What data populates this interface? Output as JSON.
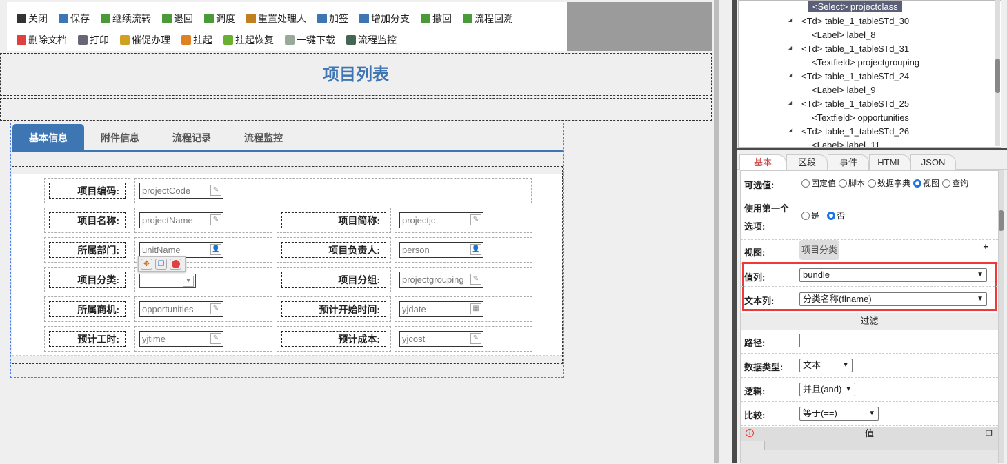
{
  "toolbar": {
    "row1": [
      {
        "label": "关闭",
        "icon": "close-icon",
        "color": "#333"
      },
      {
        "label": "保存",
        "icon": "save-icon",
        "color": "#3e76b4"
      },
      {
        "label": "继续流转",
        "icon": "forward-icon",
        "color": "#4a9a3a"
      },
      {
        "label": "退回",
        "icon": "back-arrow-icon",
        "color": "#4a9a3a"
      },
      {
        "label": "调度",
        "icon": "dispatch-icon",
        "color": "#4a9a3a"
      },
      {
        "label": "重置处理人",
        "icon": "reset-user-icon",
        "color": "#c08020"
      },
      {
        "label": "加签",
        "icon": "add-signer-icon",
        "color": "#3e76b4"
      },
      {
        "label": "增加分支",
        "icon": "branch-icon",
        "color": "#3e76b4"
      },
      {
        "label": "撤回",
        "icon": "undo-icon",
        "color": "#4a9a3a"
      },
      {
        "label": "流程回溯",
        "icon": "history-icon",
        "color": "#4a9a3a"
      }
    ],
    "row2": [
      {
        "label": "删除文档",
        "icon": "delete-icon",
        "color": "#e04040"
      },
      {
        "label": "打印",
        "icon": "print-icon",
        "color": "#667"
      },
      {
        "label": "催促办理",
        "icon": "bell-icon",
        "color": "#d0a020"
      },
      {
        "label": "挂起",
        "icon": "pause-icon",
        "color": "#e08020"
      },
      {
        "label": "挂起恢复",
        "icon": "resume-icon",
        "color": "#6ab030"
      },
      {
        "label": "一键下载",
        "icon": "download-icon",
        "color": "#9a9"
      },
      {
        "label": "流程监控",
        "icon": "monitor-icon",
        "color": "#465"
      }
    ]
  },
  "page_title": "项目列表",
  "tabs": [
    "基本信息",
    "附件信息",
    "流程记录",
    "流程监控"
  ],
  "form": [
    {
      "label": "项目编码:",
      "field": "projectCode",
      "btn": "edit"
    },
    {
      "label": "项目名称:",
      "field": "projectName",
      "btn": "edit"
    },
    {
      "label": "项目简称:",
      "field": "projectjc",
      "btn": "edit"
    },
    {
      "label": "所属部门:",
      "field": "unitName",
      "btn": "user"
    },
    {
      "label": "项目负责人:",
      "field": "person",
      "btn": "user"
    },
    {
      "label": "项目分类:",
      "field": "",
      "btn": "select"
    },
    {
      "label": "项目分组:",
      "field": "projectgrouping",
      "btn": "edit"
    },
    {
      "label": "所属商机:",
      "field": "opportunities",
      "btn": "edit"
    },
    {
      "label": "预计开始时间:",
      "field": "yjdate",
      "btn": "calendar"
    },
    {
      "label": "预计工时:",
      "field": "yjtime",
      "btn": "edit"
    },
    {
      "label": "预计成本:",
      "field": "yjcost",
      "btn": "edit"
    }
  ],
  "tree": [
    {
      "text": "<Select> projectclass",
      "level": 2,
      "selected": true
    },
    {
      "text": "<Td> table_1_table$Td_30",
      "level": 1
    },
    {
      "text": "<Label> label_8",
      "level": 2
    },
    {
      "text": "<Td> table_1_table$Td_31",
      "level": 1
    },
    {
      "text": "<Textfield> projectgrouping",
      "level": 2
    },
    {
      "text": "<Td> table_1_table$Td_24",
      "level": 1
    },
    {
      "text": "<Label> label_9",
      "level": 2
    },
    {
      "text": "<Td> table_1_table$Td_25",
      "level": 1
    },
    {
      "text": "<Textfield> opportunities",
      "level": 2
    },
    {
      "text": "<Td> table_1_table$Td_26",
      "level": 1
    },
    {
      "text": "<Label> label_11",
      "level": 2
    }
  ],
  "prop_tabs": [
    "基本",
    "区段",
    "事件",
    "HTML",
    "JSON"
  ],
  "props": {
    "optional_label": "可选值:",
    "optional_options": [
      "固定值",
      "脚本",
      "数据字典",
      "视图",
      "查询"
    ],
    "optional_selected": "视图",
    "first_label_1": "使用第一个",
    "first_label_2": "选项:",
    "first_yes": "是",
    "first_no": "否",
    "view_label": "视图:",
    "view_value": "项目分类",
    "add": "+",
    "value_col_label": "值列:",
    "value_col": "bundle",
    "text_col_label": "文本列:",
    "text_col": "分类名称(flname)",
    "filter_header": "过滤",
    "path_label": "路径:",
    "path_value": "",
    "dtype_label": "数据类型:",
    "dtype": "文本",
    "logic_label": "逻辑:",
    "logic": "并且(and)",
    "compare_label": "比较:",
    "compare": "等于(==)",
    "value_header": "值"
  }
}
